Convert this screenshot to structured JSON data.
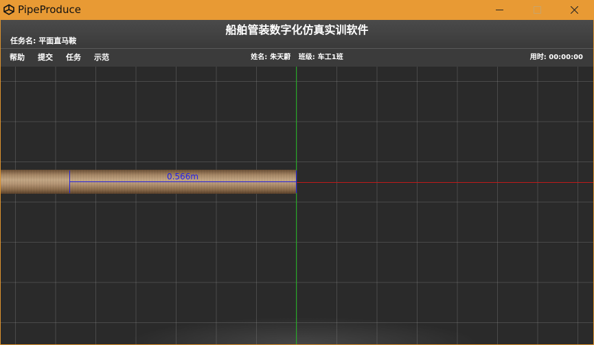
{
  "window": {
    "title": "PipeProduce",
    "logo_icon": "unity-logo-icon",
    "controls": [
      "minimize-icon",
      "maximize-icon",
      "close-icon"
    ],
    "accent": "#e89a34"
  },
  "header": {
    "title": "船舶管装数字化仿真实训软件",
    "task_label": "任务名: ",
    "task_name": "平面直马鞍"
  },
  "menu": {
    "items": [
      {
        "label": "帮助"
      },
      {
        "label": "提交"
      },
      {
        "label": "任务"
      },
      {
        "label": "示范"
      }
    ]
  },
  "student": {
    "name_label": "姓名:",
    "name": "朱天蔚",
    "class_label": "班级:",
    "class": "车工1班"
  },
  "timer": {
    "label": "用时: ",
    "value": "00:00:00"
  },
  "viewport": {
    "dimension_label": "0.566m",
    "colors": {
      "x_axis": "#c01a1a",
      "y_axis": "#1fae1f",
      "dimension": "#2222dd",
      "pipe": "#b39373"
    }
  }
}
